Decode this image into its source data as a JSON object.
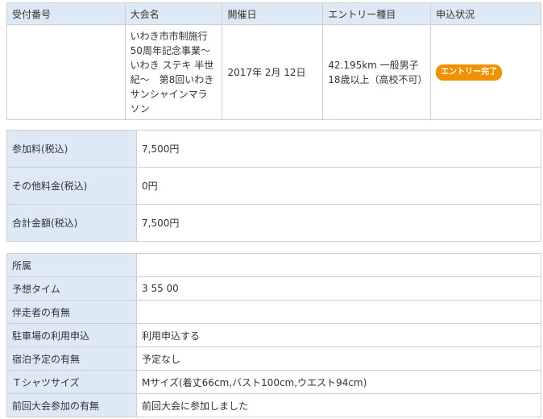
{
  "entry_table": {
    "headers": [
      "受付番号",
      "大会名",
      "開催日",
      "エントリー種目",
      "申込状況"
    ],
    "row": {
      "receipt_number": "",
      "event_name": "いわき市市制施行50周年記念事業～いわき ステキ 半世紀～　第8回いわきサンシャインマラソン",
      "date": "2017年 2月 12日",
      "category": "42.195km 一般男子　18歳以上（高校不可）",
      "status": "エントリー完了"
    },
    "status_color": "#f29100"
  },
  "fees": [
    {
      "label": "参加料(税込)",
      "value": "7,500円"
    },
    {
      "label": "その他料金(税込)",
      "value": "0円"
    },
    {
      "label": "合計金額(税込)",
      "value": "7,500円"
    }
  ],
  "details": [
    {
      "label": "所属",
      "value": ""
    },
    {
      "label": "予想タイム",
      "value": "3 55 00"
    },
    {
      "label": "伴走者の有無",
      "value": ""
    },
    {
      "label": "駐車場の利用申込",
      "value": "利用申込する"
    },
    {
      "label": "宿泊予定の有無",
      "value": "予定なし"
    },
    {
      "label": "Ｔシャツサイズ",
      "value": "Mサイズ(着丈66cm,バスト100cm,ウエスト94cm)"
    },
    {
      "label": "前回大会参加の有無",
      "value": "前回大会に参加しました"
    }
  ],
  "label_color": "#dde9f5"
}
